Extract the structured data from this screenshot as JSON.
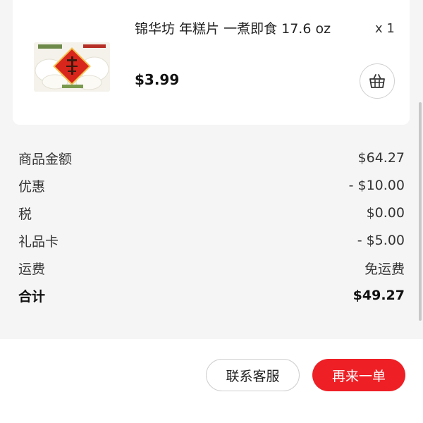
{
  "item": {
    "name": "锦华坊 年糕片 一煮即食  17.6 oz",
    "quantity": "x 1",
    "price": "$3.99",
    "add_to_cart_icon": "basket-icon"
  },
  "summary": {
    "rows": [
      {
        "label": "商品金额",
        "value": "$64.27"
      },
      {
        "label": "优惠",
        "value": "- $10.00"
      },
      {
        "label": "税",
        "value": "$0.00"
      },
      {
        "label": "礼品卡",
        "value": "- $5.00"
      },
      {
        "label": "运费",
        "value": "免运费"
      }
    ],
    "total_label": "合计",
    "total_value": "$49.27"
  },
  "actions": {
    "contact_label": "联系客服",
    "reorder_label": "再来一单"
  },
  "colors": {
    "accent": "#ee1f25",
    "background": "#f5f5f5",
    "card": "#ffffff"
  }
}
